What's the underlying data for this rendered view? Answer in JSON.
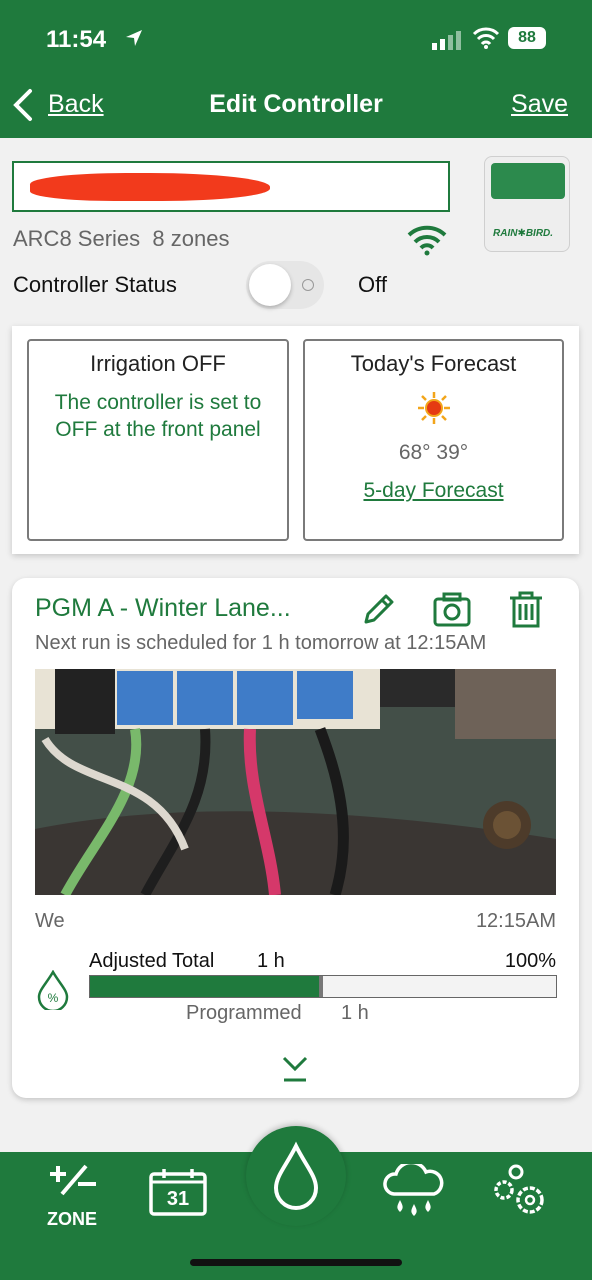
{
  "status_bar": {
    "time": "11:54",
    "battery": "88",
    "icons": [
      "location-arrow-icon",
      "cellular-signal-icon",
      "wifi-icon",
      "battery-icon"
    ]
  },
  "nav": {
    "back_label": "Back",
    "title": "Edit Controller",
    "save_label": "Save"
  },
  "controller": {
    "name_value": "",
    "series": "ARC8 Series",
    "zones": "8 zones",
    "brand": "RAIN✱BIRD.",
    "status_label": "Controller Status",
    "status_value": "Off",
    "toggle_on": false
  },
  "irrigation": {
    "title": "Irrigation OFF",
    "message": "The controller is set to OFF at the front panel"
  },
  "forecast": {
    "title": "Today's Forecast",
    "icon": "sun-icon",
    "temps": "68° 39°",
    "link": "5-day Forecast"
  },
  "program": {
    "title": "PGM A - Winter Lane...",
    "next_run": "Next run is scheduled for 1 h tomorrow at 12:15AM",
    "day": "We",
    "start_time": "12:15AM",
    "adjusted_label": "Adjusted Total",
    "adjusted_duration": "1 h",
    "adjusted_percent": "100%",
    "adjusted_fraction": 0.5,
    "programmed_label": "Programmed",
    "programmed_duration": "1 h",
    "colors": {
      "accent": "#1f7a3d"
    }
  },
  "tabbar": {
    "zone_label": "ZONE",
    "calendar_day": "31",
    "icons": [
      "zone-add-remove-icon",
      "calendar-icon",
      "water-drop-icon",
      "weather-rain-icon",
      "settings-gears-icon"
    ]
  }
}
